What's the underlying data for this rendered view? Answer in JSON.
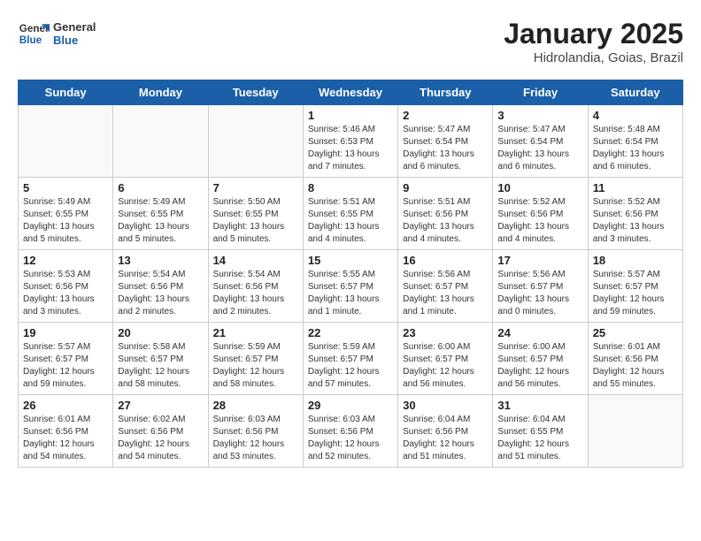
{
  "header": {
    "logo_general": "General",
    "logo_blue": "Blue",
    "month_title": "January 2025",
    "subtitle": "Hidrolandia, Goias, Brazil"
  },
  "weekdays": [
    "Sunday",
    "Monday",
    "Tuesday",
    "Wednesday",
    "Thursday",
    "Friday",
    "Saturday"
  ],
  "weeks": [
    [
      {
        "day": "",
        "info": ""
      },
      {
        "day": "",
        "info": ""
      },
      {
        "day": "",
        "info": ""
      },
      {
        "day": "1",
        "info": "Sunrise: 5:46 AM\nSunset: 6:53 PM\nDaylight: 13 hours and 7 minutes."
      },
      {
        "day": "2",
        "info": "Sunrise: 5:47 AM\nSunset: 6:54 PM\nDaylight: 13 hours and 6 minutes."
      },
      {
        "day": "3",
        "info": "Sunrise: 5:47 AM\nSunset: 6:54 PM\nDaylight: 13 hours and 6 minutes."
      },
      {
        "day": "4",
        "info": "Sunrise: 5:48 AM\nSunset: 6:54 PM\nDaylight: 13 hours and 6 minutes."
      }
    ],
    [
      {
        "day": "5",
        "info": "Sunrise: 5:49 AM\nSunset: 6:55 PM\nDaylight: 13 hours and 5 minutes."
      },
      {
        "day": "6",
        "info": "Sunrise: 5:49 AM\nSunset: 6:55 PM\nDaylight: 13 hours and 5 minutes."
      },
      {
        "day": "7",
        "info": "Sunrise: 5:50 AM\nSunset: 6:55 PM\nDaylight: 13 hours and 5 minutes."
      },
      {
        "day": "8",
        "info": "Sunrise: 5:51 AM\nSunset: 6:55 PM\nDaylight: 13 hours and 4 minutes."
      },
      {
        "day": "9",
        "info": "Sunrise: 5:51 AM\nSunset: 6:56 PM\nDaylight: 13 hours and 4 minutes."
      },
      {
        "day": "10",
        "info": "Sunrise: 5:52 AM\nSunset: 6:56 PM\nDaylight: 13 hours and 4 minutes."
      },
      {
        "day": "11",
        "info": "Sunrise: 5:52 AM\nSunset: 6:56 PM\nDaylight: 13 hours and 3 minutes."
      }
    ],
    [
      {
        "day": "12",
        "info": "Sunrise: 5:53 AM\nSunset: 6:56 PM\nDaylight: 13 hours and 3 minutes."
      },
      {
        "day": "13",
        "info": "Sunrise: 5:54 AM\nSunset: 6:56 PM\nDaylight: 13 hours and 2 minutes."
      },
      {
        "day": "14",
        "info": "Sunrise: 5:54 AM\nSunset: 6:56 PM\nDaylight: 13 hours and 2 minutes."
      },
      {
        "day": "15",
        "info": "Sunrise: 5:55 AM\nSunset: 6:57 PM\nDaylight: 13 hours and 1 minute."
      },
      {
        "day": "16",
        "info": "Sunrise: 5:56 AM\nSunset: 6:57 PM\nDaylight: 13 hours and 1 minute."
      },
      {
        "day": "17",
        "info": "Sunrise: 5:56 AM\nSunset: 6:57 PM\nDaylight: 13 hours and 0 minutes."
      },
      {
        "day": "18",
        "info": "Sunrise: 5:57 AM\nSunset: 6:57 PM\nDaylight: 12 hours and 59 minutes."
      }
    ],
    [
      {
        "day": "19",
        "info": "Sunrise: 5:57 AM\nSunset: 6:57 PM\nDaylight: 12 hours and 59 minutes."
      },
      {
        "day": "20",
        "info": "Sunrise: 5:58 AM\nSunset: 6:57 PM\nDaylight: 12 hours and 58 minutes."
      },
      {
        "day": "21",
        "info": "Sunrise: 5:59 AM\nSunset: 6:57 PM\nDaylight: 12 hours and 58 minutes."
      },
      {
        "day": "22",
        "info": "Sunrise: 5:59 AM\nSunset: 6:57 PM\nDaylight: 12 hours and 57 minutes."
      },
      {
        "day": "23",
        "info": "Sunrise: 6:00 AM\nSunset: 6:57 PM\nDaylight: 12 hours and 56 minutes."
      },
      {
        "day": "24",
        "info": "Sunrise: 6:00 AM\nSunset: 6:57 PM\nDaylight: 12 hours and 56 minutes."
      },
      {
        "day": "25",
        "info": "Sunrise: 6:01 AM\nSunset: 6:56 PM\nDaylight: 12 hours and 55 minutes."
      }
    ],
    [
      {
        "day": "26",
        "info": "Sunrise: 6:01 AM\nSunset: 6:56 PM\nDaylight: 12 hours and 54 minutes."
      },
      {
        "day": "27",
        "info": "Sunrise: 6:02 AM\nSunset: 6:56 PM\nDaylight: 12 hours and 54 minutes."
      },
      {
        "day": "28",
        "info": "Sunrise: 6:03 AM\nSunset: 6:56 PM\nDaylight: 12 hours and 53 minutes."
      },
      {
        "day": "29",
        "info": "Sunrise: 6:03 AM\nSunset: 6:56 PM\nDaylight: 12 hours and 52 minutes."
      },
      {
        "day": "30",
        "info": "Sunrise: 6:04 AM\nSunset: 6:56 PM\nDaylight: 12 hours and 51 minutes."
      },
      {
        "day": "31",
        "info": "Sunrise: 6:04 AM\nSunset: 6:55 PM\nDaylight: 12 hours and 51 minutes."
      },
      {
        "day": "",
        "info": ""
      }
    ]
  ]
}
